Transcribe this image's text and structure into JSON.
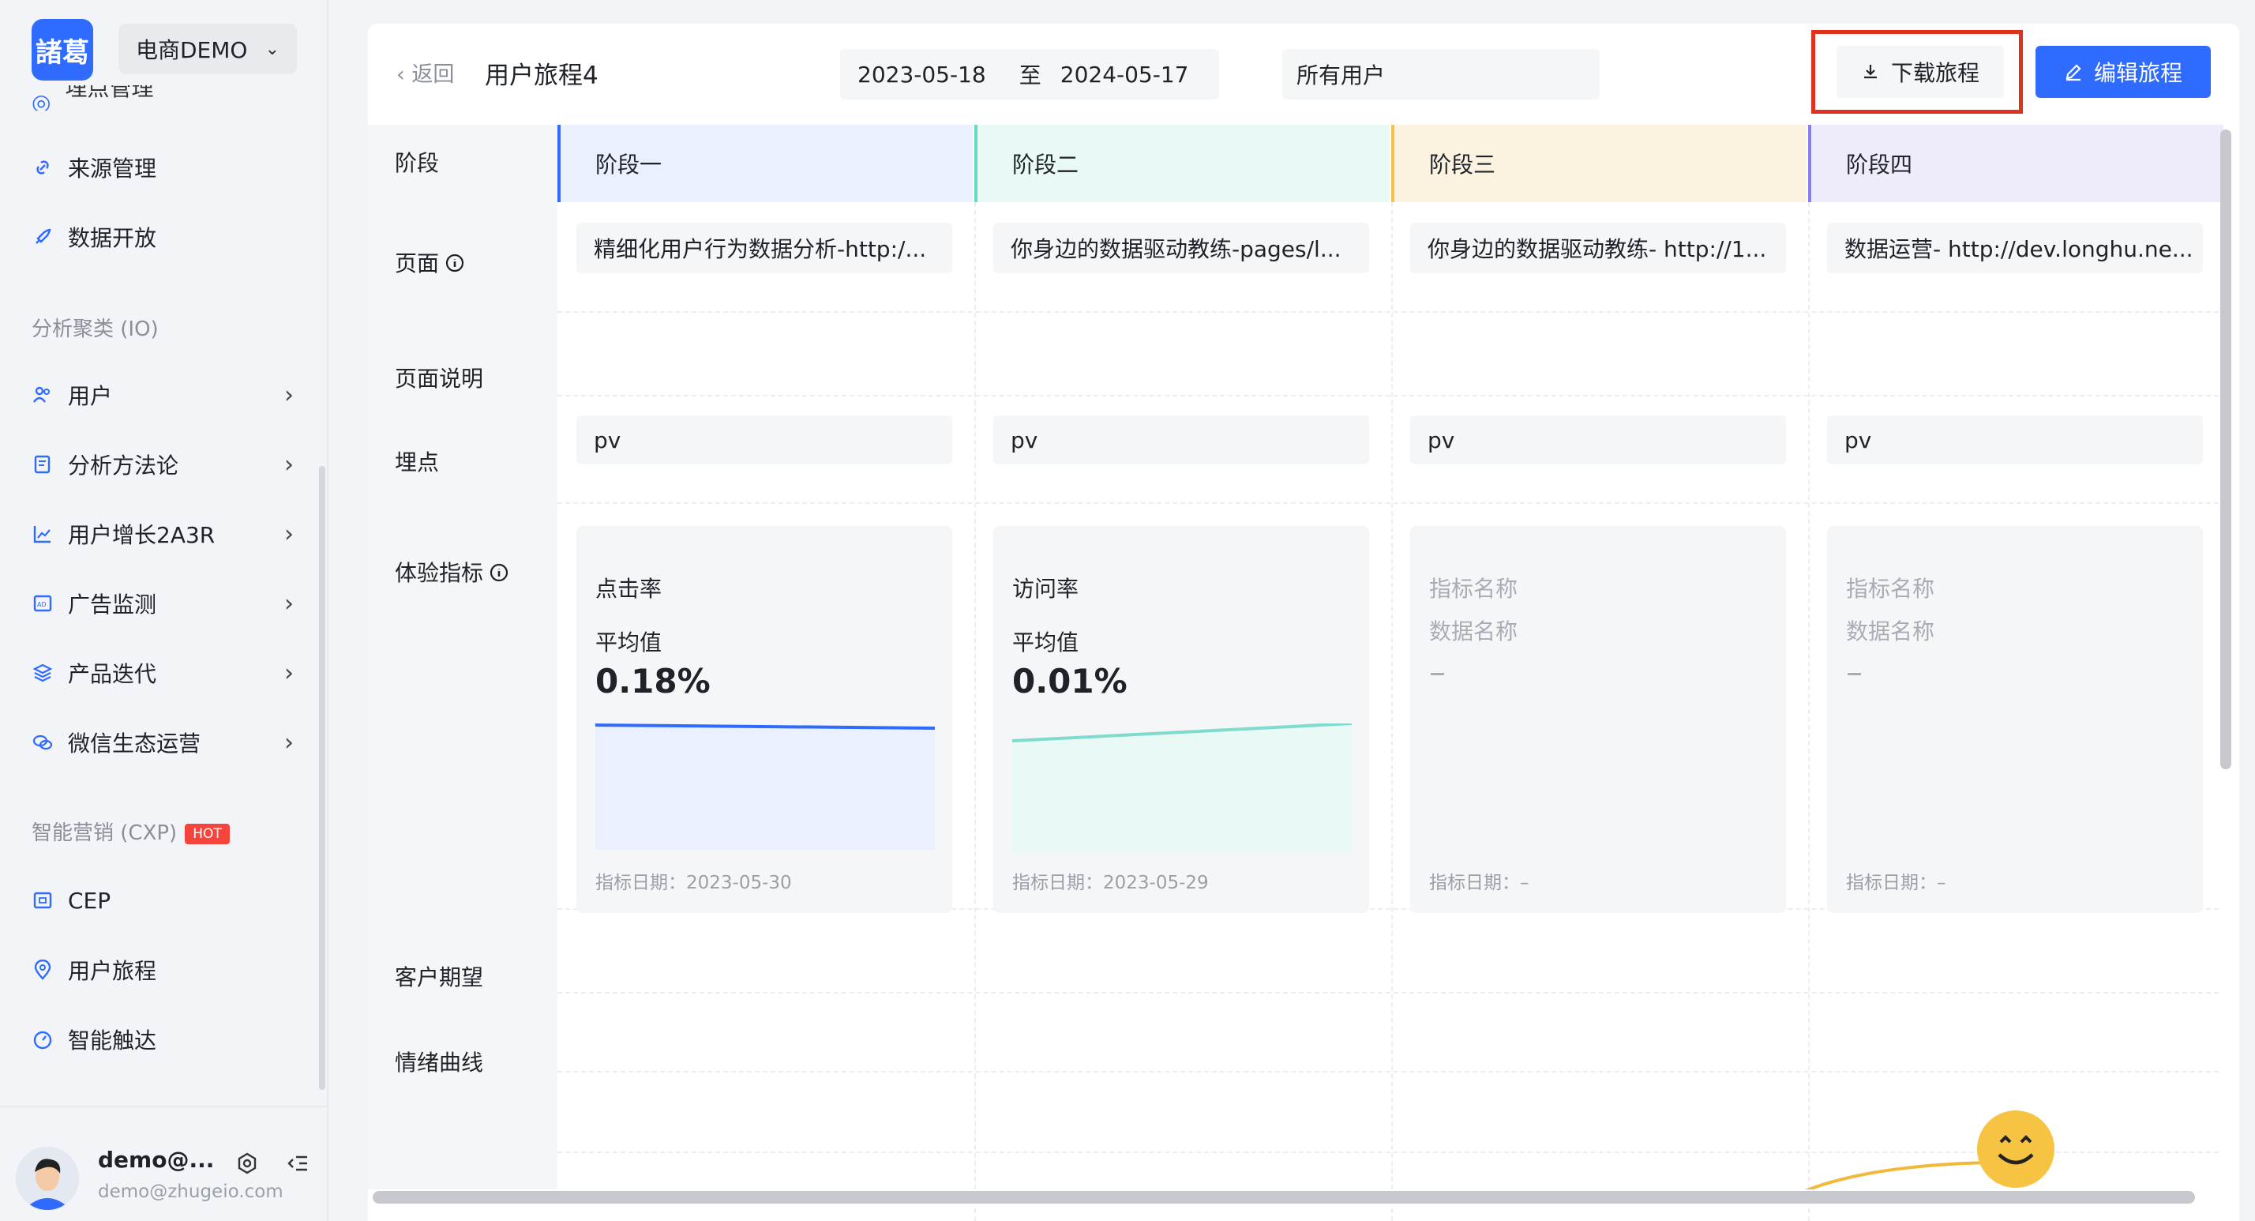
{
  "sidebar": {
    "logo_text": "諸葛",
    "project": "电商DEMO",
    "clipped_item": "埋点管理",
    "items_top": [
      {
        "label": "来源管理",
        "icon": "link-icon"
      },
      {
        "label": "数据开放",
        "icon": "rocket-icon"
      }
    ],
    "section_analysis": "分析聚类 (IO)",
    "items_analysis": [
      {
        "label": "用户",
        "icon": "users-icon"
      },
      {
        "label": "分析方法论",
        "icon": "book-icon"
      },
      {
        "label": "用户增长2A3R",
        "icon": "line-chart-icon"
      },
      {
        "label": "广告监测",
        "icon": "ad-icon"
      },
      {
        "label": "产品迭代",
        "icon": "layers-icon"
      },
      {
        "label": "微信生态运营",
        "icon": "wechat-icon"
      }
    ],
    "section_marketing": "智能营销 (CXP)",
    "hot_badge": "HOT",
    "items_marketing": [
      {
        "label": "CEP",
        "icon": "cep-icon"
      },
      {
        "label": "用户旅程",
        "icon": "location-icon"
      },
      {
        "label": "智能触达",
        "icon": "compass-icon"
      }
    ],
    "user": {
      "name": "demo@...",
      "email": "demo@zhugeio.com"
    }
  },
  "header": {
    "back": "返回",
    "title": "用户旅程4",
    "date_start": "2023-05-18",
    "date_sep": "至",
    "date_end": "2024-05-17",
    "user_filter": "所有用户",
    "download_label": "下载旅程",
    "edit_label": "编辑旅程"
  },
  "rows": {
    "stage": "阶段",
    "page": "页面",
    "page_desc": "页面说明",
    "event": "埋点",
    "metrics": "体验指标",
    "expectation": "客户期望",
    "emotion": "情绪曲线"
  },
  "stages": [
    {
      "name": "阶段一",
      "page": "精细化用户行为数据分析-http:/...",
      "event": "pv",
      "metric": {
        "name": "点击率",
        "sub": "平均值",
        "value": "0.18%",
        "date": "指标日期：2023-05-30",
        "empty": false
      }
    },
    {
      "name": "阶段二",
      "page": "你身边的数据驱动教练-pages/l...",
      "event": "pv",
      "metric": {
        "name": "访问率",
        "sub": "平均值",
        "value": "0.01%",
        "date": "指标日期：2023-05-29",
        "empty": false
      }
    },
    {
      "name": "阶段三",
      "page": "你身边的数据驱动教练- http://1...",
      "event": "pv",
      "metric": {
        "name": "指标名称",
        "sub": "数据名称",
        "value": "–",
        "date": "指标日期：–",
        "empty": true
      }
    },
    {
      "name": "阶段四",
      "page": "数据运营- http://dev.longhu.ne...",
      "event": "pv",
      "metric": {
        "name": "指标名称",
        "sub": "数据名称",
        "value": "–",
        "date": "指标日期：–",
        "empty": true
      }
    }
  ],
  "colors": {
    "accent": "#2f6bff",
    "stage1_bg": "#eaf0fd",
    "stage1_border": "#2f6bff",
    "stage2_bg": "#e8f9f6",
    "stage2_border": "#66d9c6",
    "stage3_bg": "#fbf3e0",
    "stage3_border": "#f2c14e",
    "stage4_bg": "#eeecfb",
    "stage4_border": "#8a7ef0",
    "highlight": "#e0301e"
  }
}
